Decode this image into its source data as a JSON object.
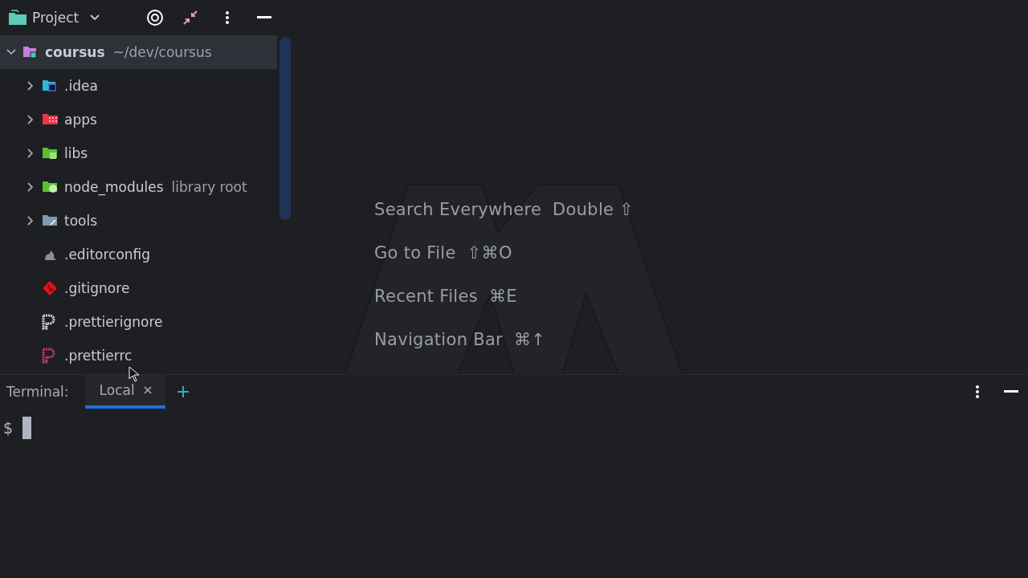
{
  "project_panel": {
    "title": "Project",
    "tree": [
      {
        "label": "coursus",
        "secondary": "~/dev/coursus",
        "kind": "project-folder",
        "expanded": true,
        "selected": true,
        "children": [
          {
            "label": ".idea",
            "kind": "idea-folder",
            "expanded": false,
            "selected": false
          },
          {
            "label": "apps",
            "kind": "apps-folder",
            "expanded": false,
            "selected": false
          },
          {
            "label": "libs",
            "kind": "libs-folder",
            "expanded": false,
            "selected": false
          },
          {
            "label": "node_modules",
            "secondary": "library root",
            "kind": "modules-folder",
            "expanded": false,
            "selected": false
          },
          {
            "label": "tools",
            "kind": "tools-folder",
            "expanded": false,
            "selected": false
          },
          {
            "label": ".editorconfig",
            "kind": "config-file",
            "selected": false
          },
          {
            "label": ".gitignore",
            "kind": "git-file",
            "selected": false
          },
          {
            "label": ".prettierignore",
            "kind": "prettier-file",
            "selected": false
          },
          {
            "label": ".prettierrc",
            "kind": "prettierrc-file",
            "selected": false
          }
        ]
      }
    ]
  },
  "editor_hints": [
    {
      "action": "Search Everywhere",
      "shortcut": "Double ⇧"
    },
    {
      "action": "Go to File",
      "shortcut": "⇧⌘O"
    },
    {
      "action": "Recent Files",
      "shortcut": "⌘E"
    },
    {
      "action": "Navigation Bar",
      "shortcut": "⌘↑"
    }
  ],
  "terminal": {
    "label": "Terminal:",
    "tabs": [
      {
        "label": "Local",
        "selected": true
      }
    ],
    "prompt": "$"
  }
}
